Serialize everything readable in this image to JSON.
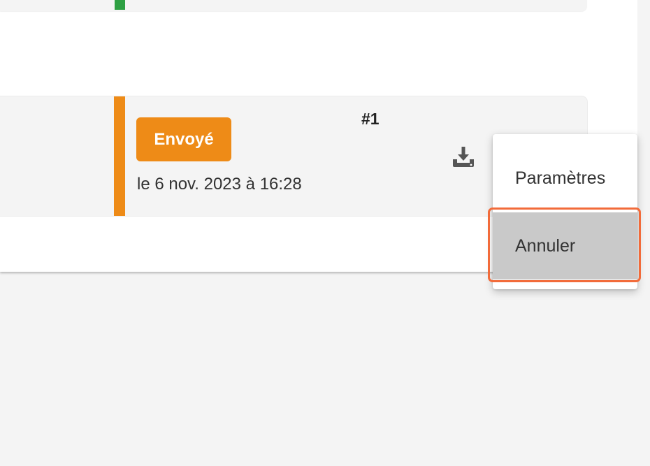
{
  "order_card": {
    "status_badge": "Envoyé",
    "date": "le 6 nov. 2023 à 16:28",
    "order_number": "#1",
    "accent_color": "#ee8b17"
  },
  "previous_card": {
    "accent_color": "#2ea043"
  },
  "actions": {
    "download_icon": "download-icon"
  },
  "context_menu": {
    "items": [
      {
        "label": "Paramètres"
      },
      {
        "label": "Annuler",
        "highlighted": true
      }
    ]
  },
  "highlight_color": "#f26b3a"
}
